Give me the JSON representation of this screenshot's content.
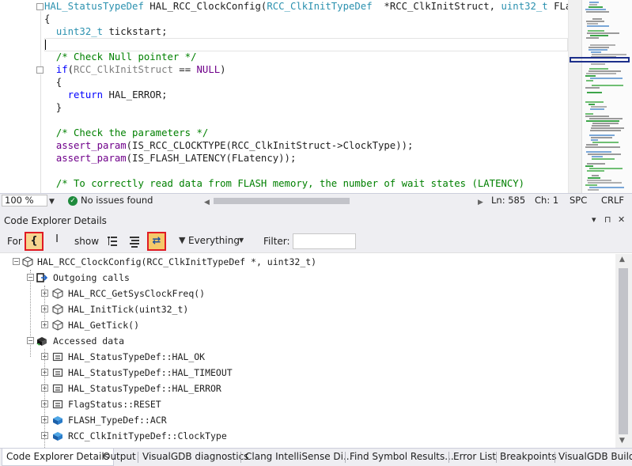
{
  "editor": {
    "code_lines": [
      [
        [
          "typ",
          "HAL_StatusTypeDef"
        ],
        [
          "pl",
          " HAL_RCC_ClockConfig("
        ],
        [
          "typ",
          "RCC_ClkInitTypeDef"
        ],
        [
          "pl",
          "  *RCC_ClkInitStruct, "
        ],
        [
          "typ",
          "uint32_t"
        ],
        [
          "pl",
          " FLatency"
        ]
      ],
      [
        [
          "pl",
          "{"
        ]
      ],
      [
        [
          "pl",
          "  "
        ],
        [
          "typ",
          "uint32_t"
        ],
        [
          "pl",
          " tickstart;"
        ]
      ],
      [
        [
          "pl",
          ""
        ]
      ],
      [
        [
          "pl",
          "  "
        ],
        [
          "cmt",
          "/* Check Null pointer */"
        ]
      ],
      [
        [
          "pl",
          "  "
        ],
        [
          "kw",
          "if"
        ],
        [
          "pl",
          "("
        ],
        [
          "par",
          "RCC_ClkInitStruct"
        ],
        [
          "pl",
          " == "
        ],
        [
          "mac",
          "NULL"
        ],
        [
          "pl",
          ")"
        ]
      ],
      [
        [
          "pl",
          "  {"
        ]
      ],
      [
        [
          "pl",
          "    "
        ],
        [
          "kw",
          "return"
        ],
        [
          "pl",
          " HAL_ERROR;"
        ]
      ],
      [
        [
          "pl",
          "  }"
        ]
      ],
      [
        [
          "pl",
          ""
        ]
      ],
      [
        [
          "pl",
          "  "
        ],
        [
          "cmt",
          "/* Check the parameters */"
        ]
      ],
      [
        [
          "pl",
          "  "
        ],
        [
          "mac",
          "assert_param"
        ],
        [
          "pl",
          "(IS_RCC_CLOCKTYPE(RCC_ClkInitStruct->ClockType));"
        ]
      ],
      [
        [
          "pl",
          "  "
        ],
        [
          "mac",
          "assert_param"
        ],
        [
          "pl",
          "(IS_FLASH_LATENCY(FLatency));"
        ]
      ],
      [
        [
          "pl",
          ""
        ]
      ],
      [
        [
          "pl",
          "  "
        ],
        [
          "cmt",
          "/* To correctly read data from FLASH memory, the number of wait states (LATENCY)"
        ]
      ]
    ]
  },
  "status_bar": {
    "zoom": "100 %",
    "issues": "No issues found",
    "line": "Ln: 585",
    "col": "Ch: 1",
    "insert_mode": "SPC",
    "line_ending": "CRLF"
  },
  "panel": {
    "title": "Code Explorer Details",
    "pin_glyph": "▾",
    "autohide_glyph": "⊓",
    "close_glyph": "✕",
    "for_label": "For",
    "show_label": "show",
    "filter_dropdown": "Everything",
    "filter_label": "Filter:",
    "filter_value": ""
  },
  "tree": {
    "root": "HAL_RCC_ClockConfig(RCC_ClkInitTypeDef *, uint32_t)",
    "outgoing_label": "Outgoing calls",
    "outgoing": [
      "HAL_RCC_GetSysClockFreq()",
      "HAL_InitTick(uint32_t)",
      "HAL_GetTick()"
    ],
    "accessed_label": "Accessed data",
    "accessed": [
      "HAL_StatusTypeDef::HAL_OK",
      "HAL_StatusTypeDef::HAL_TIMEOUT",
      "HAL_StatusTypeDef::HAL_ERROR",
      "FlagStatus::RESET",
      "FLASH_TypeDef::ACR",
      "RCC_ClkInitTypeDef::ClockType"
    ]
  },
  "bottom_tabs": [
    "Code Explorer Details",
    "Output",
    "VisualGDB diagnostics",
    "Clang IntelliSense Di...",
    "Find Symbol Results...",
    "Error List",
    "Breakpoints",
    "VisualGDB Build"
  ],
  "colors": {
    "keyword": "#0000ff",
    "type": "#2b91af",
    "comment": "#008000",
    "macro": "#6f008a",
    "highlight_border": "#e01b24",
    "selected_button": "#f7d58f"
  }
}
